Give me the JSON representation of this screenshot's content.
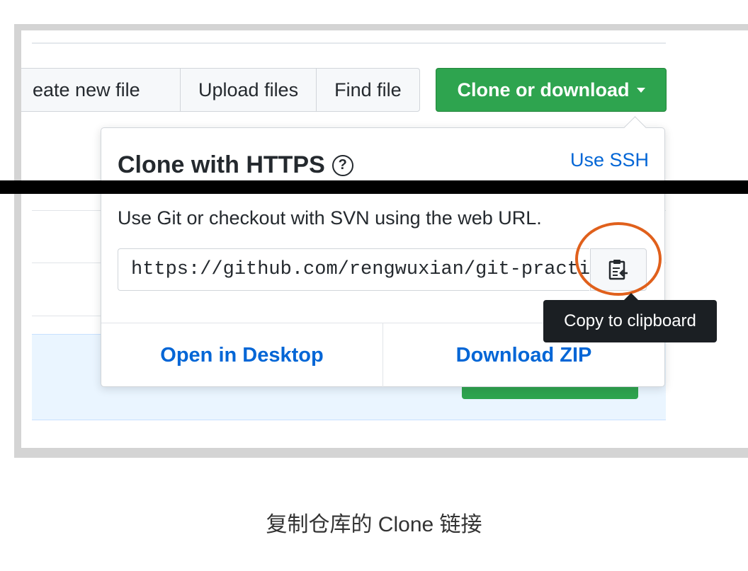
{
  "toolbar": {
    "create_new_file": "eate new file",
    "upload_files": "Upload files",
    "find_file": "Find file",
    "clone_or_download": "Clone or download"
  },
  "popover": {
    "title": "Clone with HTTPS",
    "help_symbol": "?",
    "use_ssh": "Use SSH",
    "description": "Use Git or checkout with SVN using the web URL.",
    "url_value": "https://github.com/rengwuxian/git-practice",
    "open_in_desktop": "Open in Desktop",
    "download_zip": "Download ZIP"
  },
  "tooltip": {
    "text": "Copy to clipboard"
  },
  "caption": "复制仓库的 Clone 链接",
  "colors": {
    "accent_green": "#2ea44f",
    "link_blue": "#0366d6",
    "highlight_orange": "#e0601c",
    "tooltip_bg": "#1b1f23"
  },
  "icons": {
    "help": "question-circle-icon",
    "copy": "clipboard-icon",
    "dropdown": "caret-down-icon"
  }
}
